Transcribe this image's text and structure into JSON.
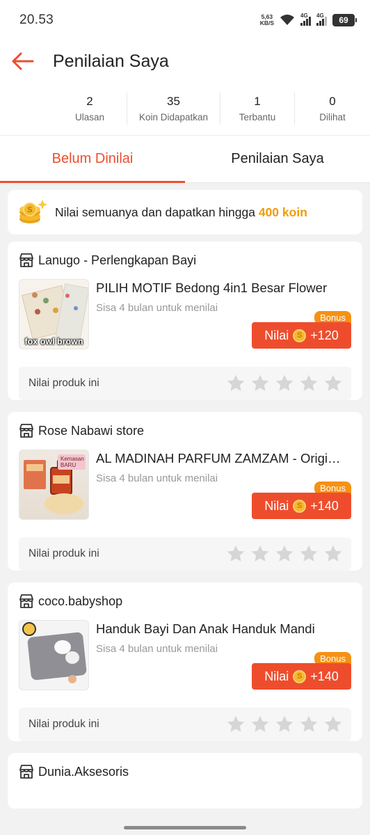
{
  "status_bar": {
    "time": "20.53",
    "net_speed_value": "5,63",
    "net_speed_unit": "KB/S",
    "signal1_label": "4G",
    "signal2_label": "4G",
    "battery": "69"
  },
  "header": {
    "title": "Penilaian Saya",
    "back_icon": "arrow-left-icon"
  },
  "stats": [
    {
      "value": "2",
      "label": "Ulasan"
    },
    {
      "value": "35",
      "label": "Koin Didapatkan"
    },
    {
      "value": "1",
      "label": "Terbantu"
    },
    {
      "value": "0",
      "label": "Dilihat"
    }
  ],
  "tabs": [
    {
      "label": "Belum Dinilai",
      "active": true
    },
    {
      "label": "Penilaian Saya",
      "active": false
    }
  ],
  "banner": {
    "text": "Nilai semuanya dan dapatkan hingga ",
    "highlight": "400 koin"
  },
  "orders": [
    {
      "shop": "Lanugo - Perlengkapan Bayi",
      "product": "PILIH MOTIF Bedong 4in1 Besar Flower",
      "deadline": "Sisa 4 bulan untuk menilai",
      "bonus": "Bonus",
      "button_label": "Nilai",
      "coins": "+120",
      "thumb_caption": "fox owl brown",
      "rate_label": "Nilai produk ini"
    },
    {
      "shop": "Rose Nabawi store",
      "product": "AL MADINAH PARFUM ZAMZAM - Original",
      "deadline": "Sisa 4 bulan untuk menilai",
      "bonus": "Bonus",
      "button_label": "Nilai",
      "coins": "+140",
      "thumb_caption": "Kemasan BARU",
      "rate_label": "Nilai produk ini"
    },
    {
      "shop": "coco.babyshop",
      "product": "Handuk Bayi Dan Anak Handuk Mandi",
      "deadline": "Sisa 4 bulan untuk menilai",
      "bonus": "Bonus",
      "button_label": "Nilai",
      "coins": "+140",
      "thumb_caption": "",
      "rate_label": "Nilai produk ini"
    }
  ],
  "partial_order": {
    "shop": "Dunia.Aksesoris"
  },
  "colors": {
    "accent": "#ee4d2d",
    "bonus": "#f69113",
    "highlight": "#f29b05"
  }
}
